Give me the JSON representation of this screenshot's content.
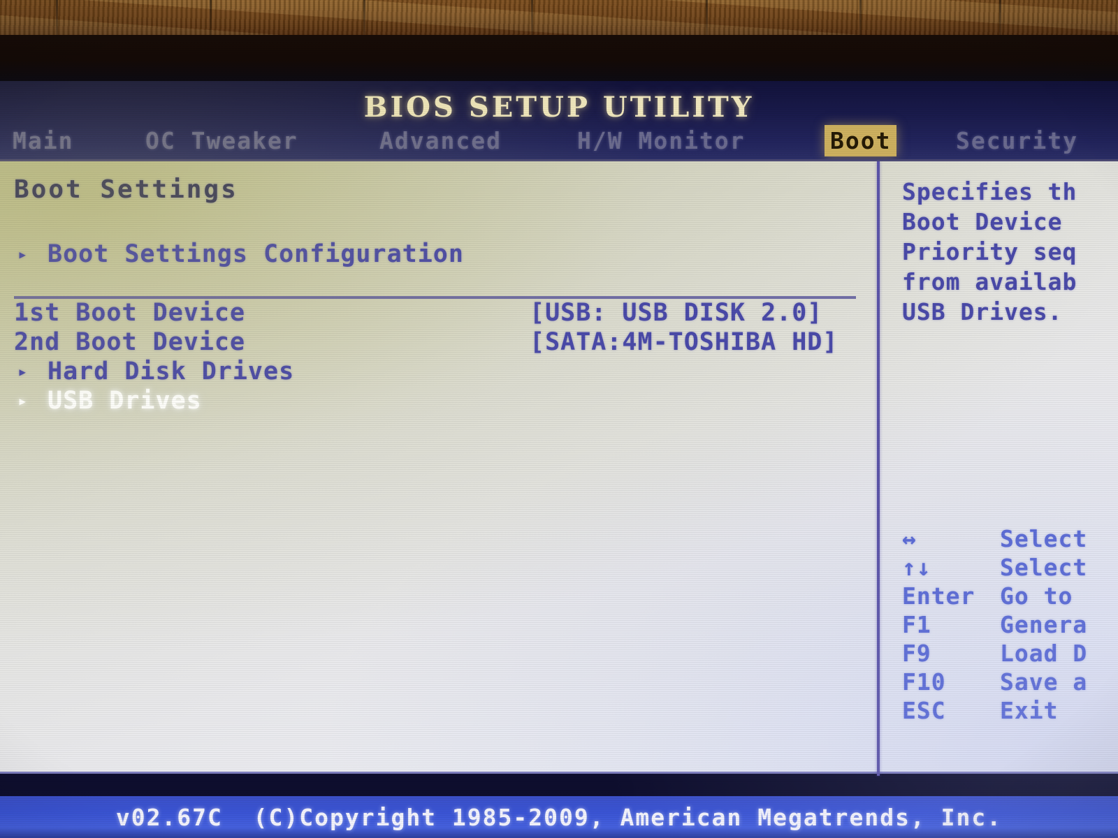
{
  "title": "BIOS SETUP UTILITY",
  "menu": {
    "tabs": [
      {
        "label": "Main",
        "active": false
      },
      {
        "label": "OC Tweaker",
        "active": false
      },
      {
        "label": "Advanced",
        "active": false
      },
      {
        "label": "H/W Monitor",
        "active": false
      },
      {
        "label": "Boot",
        "active": true
      },
      {
        "label": "Security",
        "active": false
      }
    ]
  },
  "main": {
    "section_title": "Boot Settings",
    "rows": [
      {
        "arrow": "▸",
        "label": "Boot Settings Configuration",
        "value": "",
        "selected": false
      },
      {
        "arrow": "",
        "label": "1st Boot Device",
        "value": "[USB: USB DISK 2.0]",
        "selected": false
      },
      {
        "arrow": "",
        "label": "2nd Boot Device",
        "value": "[SATA:4M-TOSHIBA HD]",
        "selected": false
      },
      {
        "arrow": "▸",
        "label": "Hard Disk Drives",
        "value": "",
        "selected": false
      },
      {
        "arrow": "▸",
        "label": "USB Drives",
        "value": "",
        "selected": true
      }
    ]
  },
  "help": {
    "lines": [
      "Specifies th",
      "Boot Device",
      "Priority seq",
      "from availab",
      "USB Drives."
    ]
  },
  "legend": {
    "rows": [
      {
        "key": "↔",
        "desc": "Select"
      },
      {
        "key": "↑↓",
        "desc": "Select"
      },
      {
        "key": "Enter",
        "desc": "Go to"
      },
      {
        "key": "F1",
        "desc": "Genera"
      },
      {
        "key": "F9",
        "desc": "Load D"
      },
      {
        "key": "F10",
        "desc": "Save a"
      },
      {
        "key": "ESC",
        "desc": "Exit"
      }
    ]
  },
  "footer": {
    "text": "v02.67C  (C)Copyright 1985-2009, American Megatrends, Inc."
  },
  "colors": {
    "title_text": "#efe6bd",
    "tab_active_bg": "#cdb05f",
    "tab_active_text": "#241a06",
    "tab_inactive_text": "#6a6a8e",
    "body_text": "#4a4aa8",
    "selected_text": "#ffffff",
    "section_title": "#3b3b5e",
    "divider": "#5b54a8",
    "footer_bg": "#3a54d4",
    "footer_text": "#f2f2fb",
    "menuband_bg": "#191a4a"
  }
}
